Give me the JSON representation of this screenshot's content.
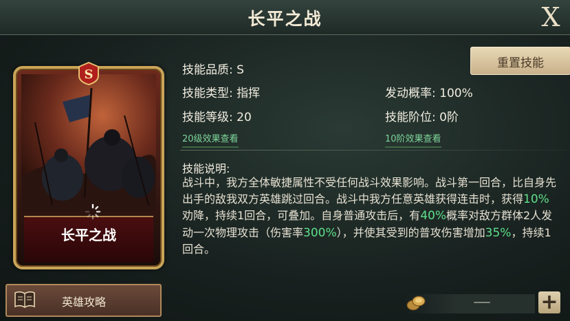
{
  "header": {
    "title": "长平之战",
    "close_label": "X"
  },
  "card": {
    "grade_badge": "S",
    "name": "长平之战"
  },
  "hero_guide": {
    "label": "英雄攻略"
  },
  "reset_button": {
    "label": "重置技能"
  },
  "stats": {
    "quality_label": "技能品质:",
    "quality_value": "S",
    "type_label": "技能类型:",
    "type_value": "指挥",
    "level_label": "技能等级:",
    "level_value": "20",
    "trigger_label": "发动概率:",
    "trigger_value": "100%",
    "rank_label": "技能阶位:",
    "rank_value": "0阶"
  },
  "links": {
    "level_effects": "20级效果查看",
    "rank_effects": "10阶效果查看"
  },
  "description": {
    "title": "技能说明:",
    "t1": "战斗中，我方全体敏捷属性不受任何战斗效果影响。战斗第一回合，比自身先出手的敌我双方英雄跳过回合。战斗中我方任意英雄获得连击时，获得",
    "v1": "10%",
    "t2": "劝降，持续1回合，可叠加。自身普通攻击后，有",
    "v2": "40%",
    "t3": "概率对敌方群体2人发动一次物理攻击（伤害率",
    "v3": "300%",
    "t4": "），并使其受到的普攻伤害增加",
    "v4": "35%",
    "t5": "，持续1回合。"
  },
  "footer": {
    "minus": "—",
    "plus": "+"
  },
  "colors": {
    "highlight": "#5fe08a",
    "gold": "#c9a458",
    "accent_link": "#7ed69a"
  }
}
